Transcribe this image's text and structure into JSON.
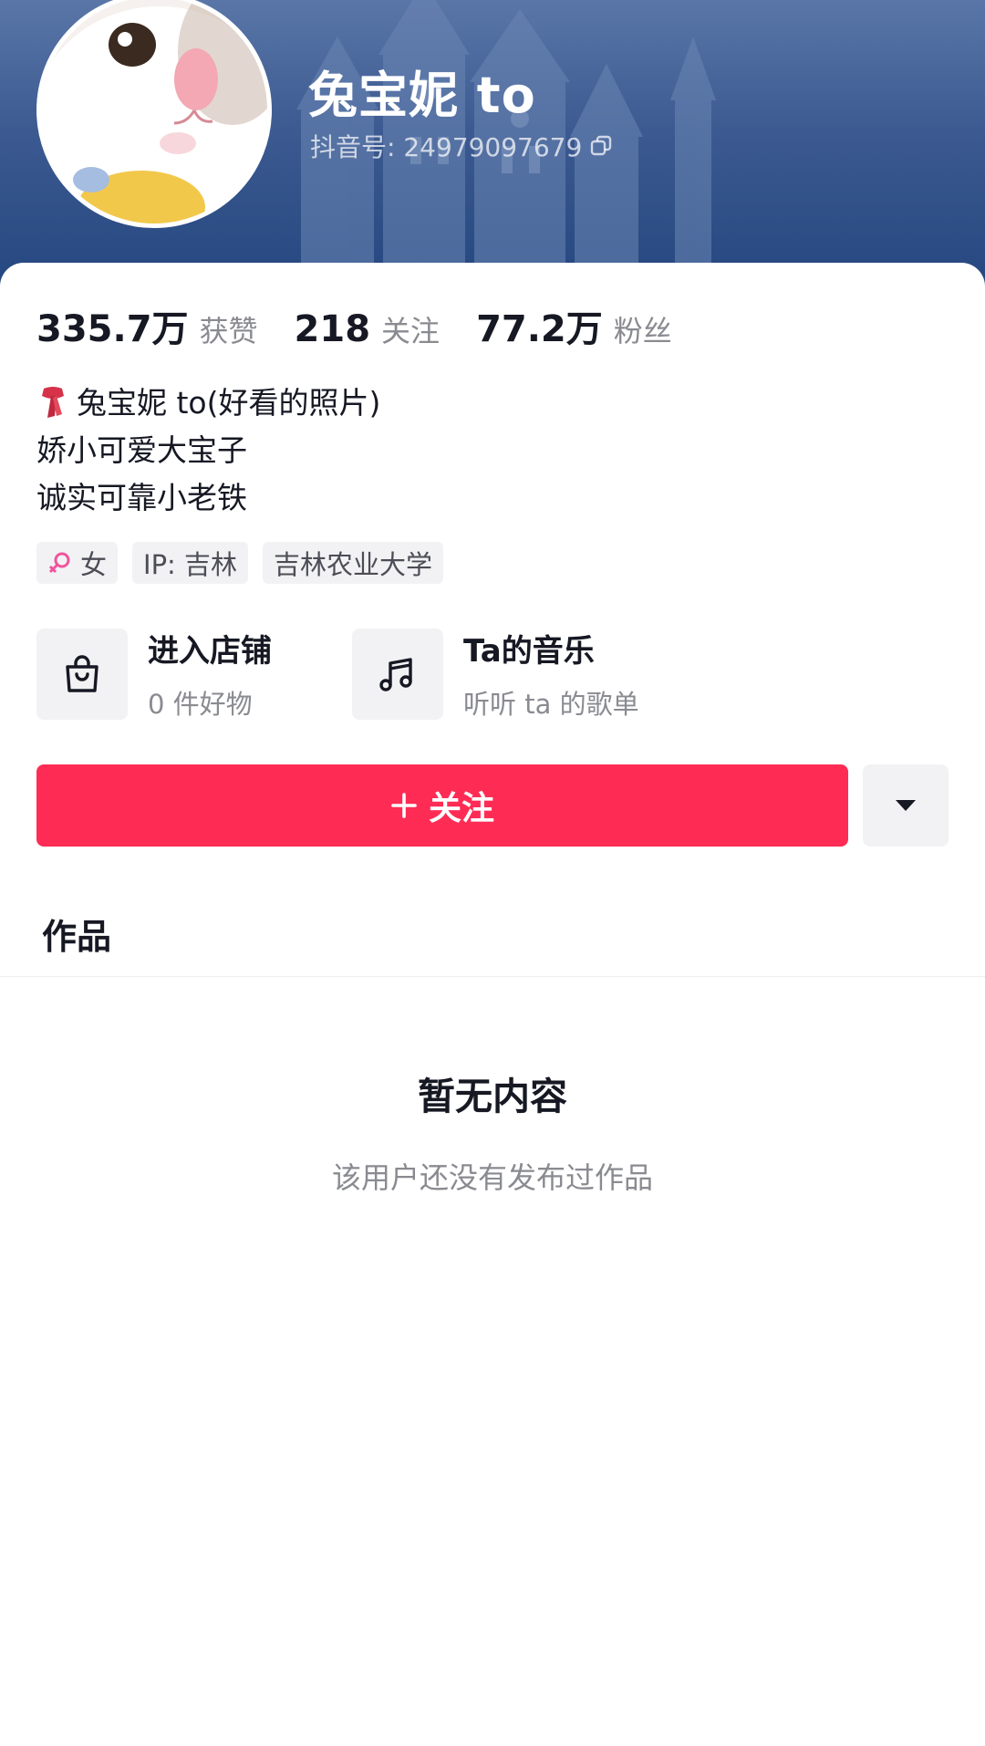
{
  "profile": {
    "name": "兔宝妮 to",
    "douyin_id": "抖音号: 24979097679"
  },
  "stats": [
    {
      "value": "335.7万",
      "label": "获赞"
    },
    {
      "value": "218",
      "label": "关注"
    },
    {
      "value": "77.2万",
      "label": "粉丝"
    }
  ],
  "bio": {
    "line1": "兔宝妮 to(好看的照片)",
    "line2": "娇小可爱大宝子",
    "line3": "诚实可靠小老铁"
  },
  "tags": {
    "gender": "女",
    "ip": "IP: 吉林",
    "school": "吉林农业大学"
  },
  "entries": {
    "shop": {
      "title": "进入店铺",
      "subtitle": "0 件好物",
      "icon": "shopping-bag-icon"
    },
    "music": {
      "title": "Ta的音乐",
      "subtitle": "听听 ta 的歌单",
      "icon": "music-note-icon"
    }
  },
  "actions": {
    "follow_label": "关注",
    "more_icon": "caret-down-icon"
  },
  "tabs": {
    "works": "作品"
  },
  "empty_state": {
    "title": "暂无内容",
    "subtitle": "该用户还没有发布过作品"
  },
  "colors": {
    "accent": "#fe2c55",
    "banner": "#2a4a82",
    "text_primary": "#161823",
    "text_secondary": "#8a8b91",
    "chip_bg": "#f2f2f4"
  }
}
